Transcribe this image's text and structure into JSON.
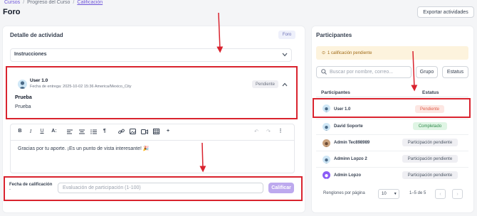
{
  "breadcrumb": [
    "Cursos",
    "Progreso del Curso",
    "Calificación"
  ],
  "page_title": "Foro",
  "export_label": "Exportar actividades",
  "detail": {
    "title": "Detalle de actividad",
    "type_badge": "Foro",
    "instructions_label": "Instrucciones",
    "submission": {
      "user": "User 1.0",
      "due": "Fecha de entrega: 2025-10-02 15:36 America/Mexico_City",
      "status": "Pendiente",
      "title": "Prueba",
      "body": "Prueba"
    },
    "editor_text": "Gracias por tu aporte. ¡Es un punto de vista interesante! 🎉",
    "grade_label": "Fecha de calificación",
    "grade_dash": "-",
    "grade_placeholder": "Evaluación de participación (1-100)",
    "grade_button": "Calificar"
  },
  "participants": {
    "title": "Participantes",
    "alert": "1 calificación pendiente",
    "search_placeholder": "Buscar por nombre, correo...",
    "group_label": "Grupo",
    "status_filter_label": "Estatus",
    "col_participants": "Participantes",
    "col_status": "Estatus",
    "rows": [
      {
        "name": "User 1.0",
        "status": "Pendiente"
      },
      {
        "name": "David Soporte",
        "status": "Completado"
      },
      {
        "name": "Admin Tec898989",
        "status": "Participación pendiente"
      },
      {
        "name": "Adminn Lopzo 2",
        "status": "Participación pendiente"
      },
      {
        "name": "Admin Lopzo",
        "status": "Participación pendiente"
      }
    ],
    "rows_per_page_label": "Renglones por página",
    "rows_per_page": "10",
    "range": "1–5 de 5"
  },
  "colors": {
    "accent": "#6d54d9",
    "highlight": "#d9232e",
    "pending": "#e05d4a",
    "complete": "#2f8a4b"
  }
}
